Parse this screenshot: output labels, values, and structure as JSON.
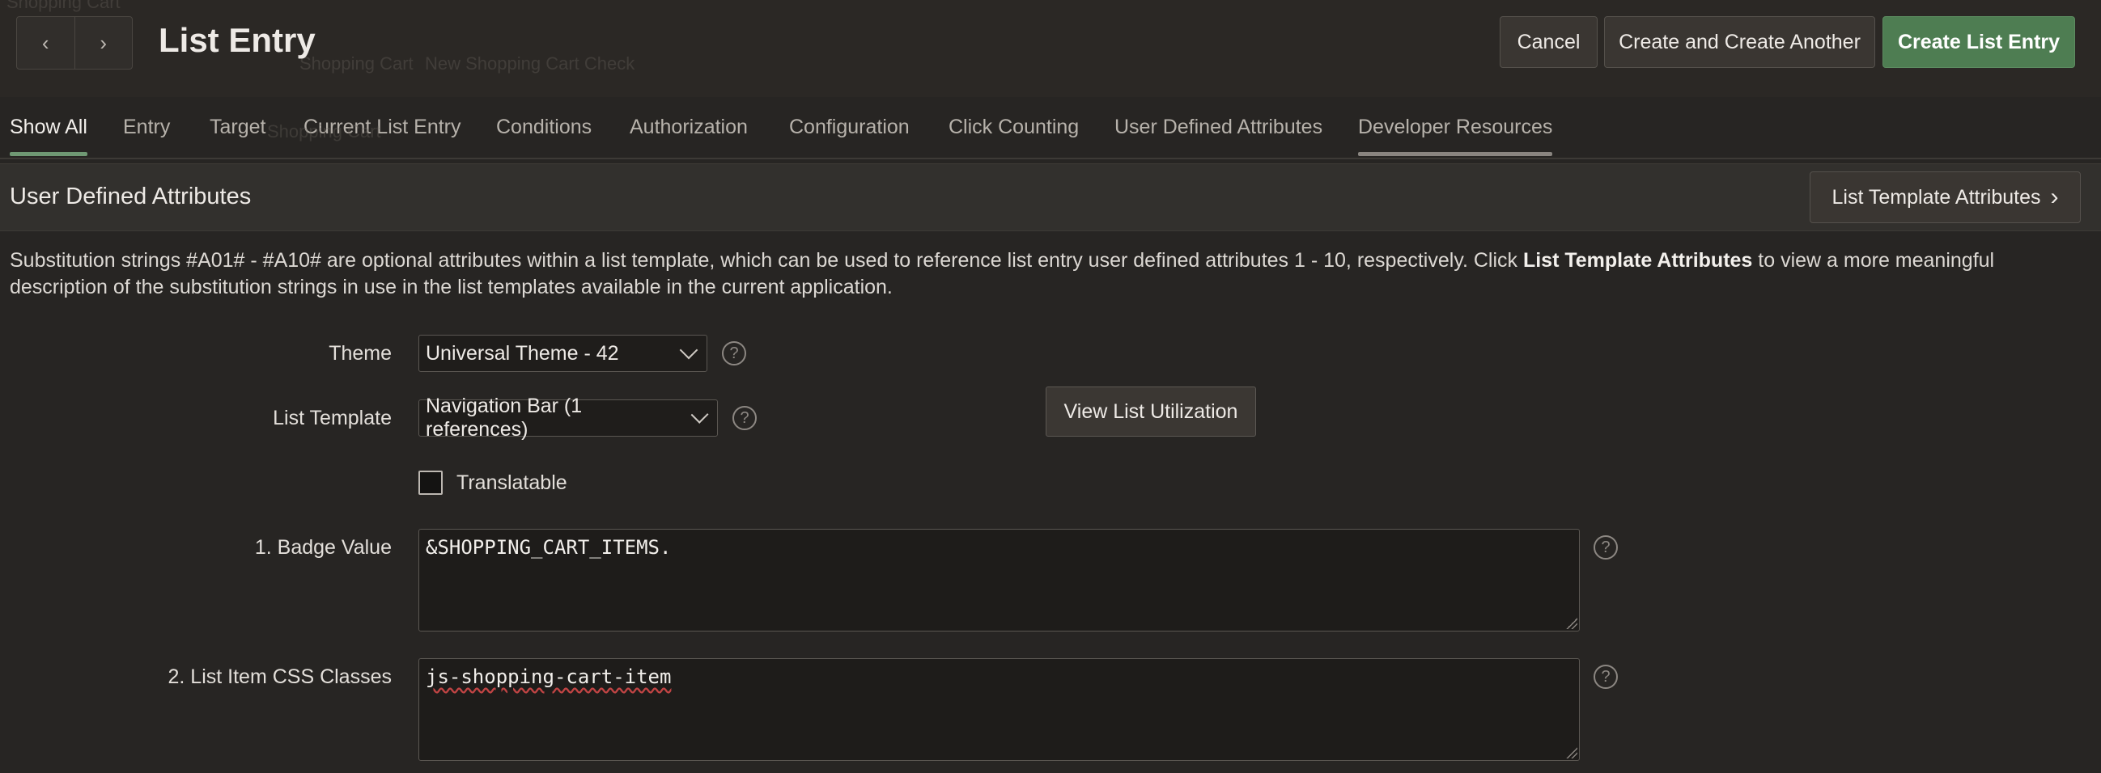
{
  "header": {
    "title": "List Entry",
    "cancel_label": "Cancel",
    "create_another_label": "Create and Create Another",
    "create_label": "Create List Entry",
    "back_icon": "‹",
    "forward_icon": "›"
  },
  "ghost": {
    "g1": "Shopping Cart",
    "g2": "Shopping Cart",
    "g3": "New Shopping Cart Check",
    "g4": "Shopping Cart"
  },
  "tabs": [
    {
      "label": "Show All"
    },
    {
      "label": "Entry"
    },
    {
      "label": "Target"
    },
    {
      "label": "Current List Entry"
    },
    {
      "label": "Conditions"
    },
    {
      "label": "Authorization"
    },
    {
      "label": "Configuration"
    },
    {
      "label": "Click Counting"
    },
    {
      "label": "User Defined Attributes"
    },
    {
      "label": "Developer Resources"
    }
  ],
  "region": {
    "title": "User Defined Attributes",
    "template_attrs_button": "List Template Attributes",
    "chevron": "›",
    "description_before": "Substitution strings #A01# - #A10# are optional attributes within a list template, which can be used to reference list entry user defined attributes 1 - 10, respectively. Click ",
    "description_bold": "List Template Attributes",
    "description_after": " to view a more meaningful description of the substitution strings in use in the list templates available in the current application."
  },
  "form": {
    "theme_label": "Theme",
    "theme_value": "Universal Theme - 42",
    "list_template_label": "List Template",
    "list_template_value": "Navigation Bar (1 references)",
    "view_utilization_button": "View List Utilization",
    "translatable_label": "Translatable",
    "translatable_checked": false,
    "badge_label": "1. Badge Value",
    "badge_value": "&SHOPPING_CART_ITEMS.",
    "css_label": "2. List Item CSS Classes",
    "css_value": "js-shopping-cart-item",
    "help_glyph": "?"
  },
  "colors": {
    "background": "#272523",
    "primary_button": "#4e7d52",
    "active_tab_underline": "#6f9873"
  }
}
